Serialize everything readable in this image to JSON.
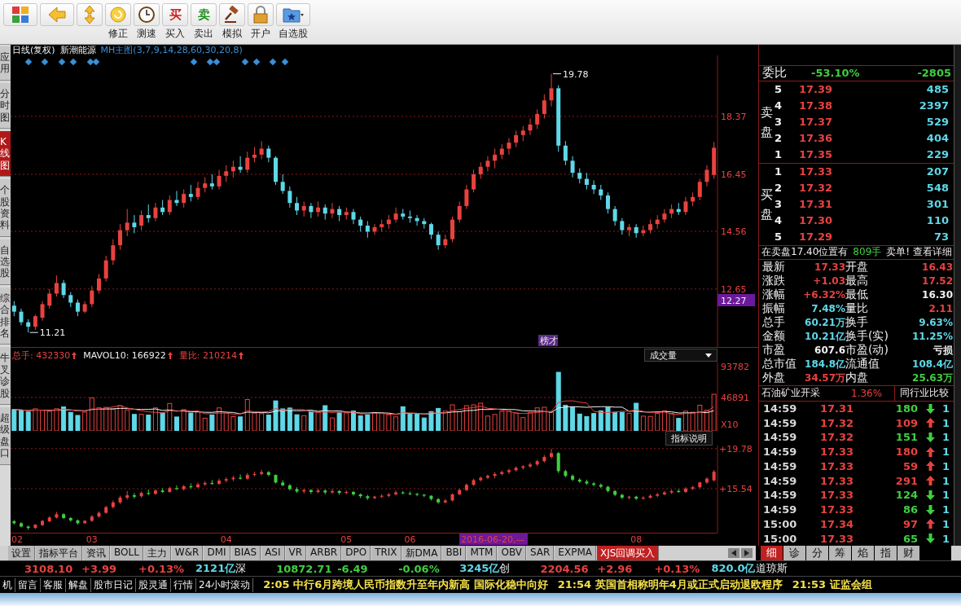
{
  "toolbar": {
    "buttons": [
      {
        "kind": "grid"
      },
      {
        "kind": "back"
      },
      {
        "kind": "updown"
      },
      {
        "kind": "refresh",
        "label": "修正"
      },
      {
        "kind": "clock",
        "label": "测速"
      },
      {
        "kind": "buy",
        "glyph": "买",
        "label": "买入"
      },
      {
        "kind": "sell",
        "glyph": "卖",
        "label": "卖出"
      },
      {
        "kind": "hammer",
        "label": "模拟"
      },
      {
        "kind": "lock",
        "label": "开户"
      },
      {
        "kind": "folder",
        "label": "自选股"
      }
    ]
  },
  "side_tabs": [
    {
      "label": "应用",
      "selected": false
    },
    {
      "label": "分时图",
      "selected": false
    },
    {
      "label": "K线图",
      "selected": true
    },
    {
      "label": "个股资料",
      "selected": false
    },
    {
      "label": "自选股",
      "selected": false
    },
    {
      "label": "综合排名",
      "selected": false
    },
    {
      "label": "牛叉诊股",
      "selected": false
    },
    {
      "label": "超级盘口",
      "selected": false
    }
  ],
  "chart": {
    "period": "日线(复权)",
    "stock": "新潮能源",
    "indicator": "MH主图(3,7,9,14,28,60,30,20,8)",
    "high_mark": "19.78",
    "low_mark": "11.21",
    "current_price": "12.27",
    "event_tag": "榜才",
    "chart_data": {
      "type": "candlestick",
      "grid": true,
      "ylim": [
        10.73,
        20.39
      ],
      "yticks": [
        {
          "value": 18.37,
          "label": "18.37"
        },
        {
          "value": 16.45,
          "label": "16.45"
        },
        {
          "value": 14.56,
          "label": "14.56"
        },
        {
          "value": 12.65,
          "label": "12.65"
        }
      ],
      "categories": [
        null,
        null,
        null,
        null,
        null,
        null,
        null,
        null,
        null,
        null,
        null,
        null,
        null,
        null,
        null,
        null,
        null,
        null,
        null,
        null,
        null,
        null,
        null,
        null,
        null,
        null,
        null,
        null,
        null,
        null,
        null,
        null,
        null,
        null,
        null,
        null,
        null,
        null,
        null,
        null,
        null,
        null,
        null,
        null,
        null,
        null,
        null,
        null,
        null,
        null,
        null,
        null,
        null,
        null,
        null,
        null,
        null,
        null,
        null,
        null,
        null,
        null,
        null,
        null,
        null,
        null,
        null,
        null,
        null,
        null,
        null,
        null,
        null,
        null,
        null,
        null,
        null,
        null,
        null,
        null,
        null,
        null,
        null,
        null,
        null,
        null,
        null,
        null,
        null,
        null,
        null,
        null,
        null,
        null,
        null,
        null,
        null,
        null,
        null,
        null
      ],
      "ohlc": [
        [
          12.1,
          12.25,
          11.75,
          11.9
        ],
        [
          11.9,
          12.0,
          11.45,
          11.55
        ],
        [
          11.55,
          11.65,
          11.21,
          11.4
        ],
        [
          11.4,
          11.8,
          11.3,
          11.75
        ],
        [
          11.7,
          12.25,
          11.6,
          12.15
        ],
        [
          12.1,
          12.65,
          12.0,
          12.5
        ],
        [
          12.5,
          13.1,
          12.4,
          12.85
        ],
        [
          12.85,
          12.95,
          12.35,
          12.45
        ],
        [
          12.45,
          12.55,
          12.05,
          12.2
        ],
        [
          12.2,
          12.3,
          11.75,
          11.9
        ],
        [
          11.9,
          12.25,
          11.85,
          12.15
        ],
        [
          12.15,
          12.75,
          12.05,
          12.6
        ],
        [
          12.6,
          13.15,
          12.5,
          13.0
        ],
        [
          13.0,
          13.75,
          12.9,
          13.6
        ],
        [
          13.6,
          14.3,
          13.45,
          14.1
        ],
        [
          14.1,
          14.8,
          13.95,
          14.6
        ],
        [
          14.6,
          15.3,
          14.4,
          14.85
        ],
        [
          14.85,
          15.1,
          14.5,
          14.7
        ],
        [
          14.75,
          15.25,
          14.6,
          15.1
        ],
        [
          15.1,
          15.45,
          14.85,
          15.0
        ],
        [
          15.0,
          15.5,
          14.9,
          15.35
        ],
        [
          15.35,
          15.6,
          15.1,
          15.2
        ],
        [
          15.2,
          15.75,
          15.1,
          15.6
        ],
        [
          15.6,
          15.9,
          15.4,
          15.5
        ],
        [
          15.5,
          15.95,
          15.35,
          15.8
        ],
        [
          15.8,
          16.1,
          15.55,
          15.7
        ],
        [
          15.7,
          16.2,
          15.6,
          16.0
        ],
        [
          16.0,
          16.35,
          15.85,
          16.15
        ],
        [
          16.15,
          16.45,
          15.95,
          16.05
        ],
        [
          16.05,
          16.6,
          15.95,
          16.4
        ],
        [
          16.4,
          16.75,
          16.2,
          16.55
        ],
        [
          16.55,
          16.9,
          16.35,
          16.7
        ],
        [
          16.7,
          17.05,
          16.5,
          16.6
        ],
        [
          16.6,
          17.2,
          16.5,
          17.0
        ],
        [
          17.0,
          17.35,
          16.85,
          17.1
        ],
        [
          17.1,
          17.55,
          16.95,
          17.3
        ],
        [
          17.3,
          17.4,
          16.85,
          17.0
        ],
        [
          17.0,
          17.05,
          16.1,
          16.2
        ],
        [
          16.2,
          16.45,
          15.8,
          15.9
        ],
        [
          15.9,
          16.05,
          15.35,
          15.5
        ],
        [
          15.5,
          15.7,
          15.1,
          15.25
        ],
        [
          15.25,
          15.55,
          15.05,
          15.4
        ],
        [
          15.4,
          15.5,
          15.0,
          15.2
        ],
        [
          15.2,
          15.55,
          15.05,
          15.35
        ],
        [
          15.35,
          15.45,
          14.95,
          15.15
        ],
        [
          15.15,
          15.5,
          15.0,
          15.3
        ],
        [
          15.3,
          15.4,
          14.9,
          15.1
        ],
        [
          15.1,
          15.35,
          14.95,
          15.2
        ],
        [
          15.2,
          15.3,
          14.8,
          14.95
        ],
        [
          14.95,
          15.05,
          14.55,
          14.75
        ],
        [
          14.75,
          14.9,
          14.35,
          14.55
        ],
        [
          14.55,
          14.8,
          14.45,
          14.7
        ],
        [
          14.7,
          14.95,
          14.55,
          14.8
        ],
        [
          14.8,
          15.1,
          14.65,
          14.95
        ],
        [
          14.95,
          15.35,
          14.85,
          15.15
        ],
        [
          15.15,
          15.3,
          14.95,
          15.05
        ],
        [
          15.05,
          15.25,
          14.85,
          15.0
        ],
        [
          15.0,
          15.1,
          14.75,
          14.9
        ],
        [
          14.9,
          15.0,
          14.65,
          14.8
        ],
        [
          14.8,
          14.85,
          14.3,
          14.45
        ],
        [
          14.45,
          14.55,
          13.95,
          14.1
        ],
        [
          14.1,
          14.45,
          14.0,
          14.3
        ],
        [
          14.3,
          15.05,
          14.2,
          14.95
        ],
        [
          14.95,
          15.55,
          14.85,
          15.4
        ],
        [
          15.4,
          16.1,
          15.3,
          15.95
        ],
        [
          15.95,
          16.6,
          15.85,
          16.45
        ],
        [
          16.45,
          16.85,
          16.3,
          16.7
        ],
        [
          16.7,
          17.05,
          16.55,
          16.9
        ],
        [
          16.9,
          17.3,
          16.65,
          17.1
        ],
        [
          17.1,
          17.45,
          16.95,
          17.3
        ],
        [
          17.3,
          17.65,
          17.1,
          17.5
        ],
        [
          17.5,
          17.9,
          17.35,
          17.75
        ],
        [
          17.75,
          18.05,
          17.55,
          17.9
        ],
        [
          17.9,
          18.3,
          17.75,
          18.1
        ],
        [
          18.1,
          18.6,
          17.95,
          18.45
        ],
        [
          18.45,
          19.1,
          18.3,
          18.9
        ],
        [
          18.9,
          19.78,
          18.7,
          19.3
        ],
        [
          19.3,
          19.4,
          17.2,
          17.4
        ],
        [
          17.4,
          17.55,
          16.75,
          16.9
        ],
        [
          16.9,
          17.05,
          16.35,
          16.5
        ],
        [
          16.5,
          16.65,
          16.15,
          16.3
        ],
        [
          16.3,
          16.5,
          15.95,
          16.1
        ],
        [
          16.1,
          16.25,
          15.8,
          15.95
        ],
        [
          15.95,
          16.1,
          15.6,
          15.75
        ],
        [
          15.75,
          15.85,
          15.15,
          15.3
        ],
        [
          15.3,
          15.4,
          14.75,
          14.9
        ],
        [
          14.9,
          15.0,
          14.45,
          14.6
        ],
        [
          14.6,
          14.8,
          14.4,
          14.7
        ],
        [
          14.7,
          14.8,
          14.35,
          14.5
        ],
        [
          14.5,
          14.75,
          14.4,
          14.6
        ],
        [
          14.6,
          14.95,
          14.5,
          14.8
        ],
        [
          14.8,
          15.1,
          14.65,
          14.95
        ],
        [
          14.95,
          15.3,
          14.85,
          15.15
        ],
        [
          15.15,
          15.45,
          15.0,
          15.3
        ],
        [
          15.3,
          15.5,
          15.1,
          15.2
        ],
        [
          15.2,
          15.7,
          15.1,
          15.55
        ],
        [
          15.55,
          15.85,
          15.4,
          15.7
        ],
        [
          15.7,
          16.3,
          15.6,
          16.2
        ],
        [
          16.2,
          16.75,
          16.05,
          16.6
        ],
        [
          16.43,
          17.52,
          16.3,
          17.33
        ]
      ]
    }
  },
  "volume": {
    "total_label": "总手:",
    "total": "432330",
    "mavol_label": "MAVOL10:",
    "mavol": "166922",
    "ratio_label": "量比:",
    "ratio": "210214",
    "selector": "成交量",
    "ticks": [
      "93782",
      "46891"
    ],
    "unit": "X10"
  },
  "indicator": {
    "explain": "指标说明",
    "chart_data": {
      "type": "candlestick",
      "grid": true,
      "ylim": [
        10.9,
        20.1
      ],
      "yticks": [
        {
          "value": 19.78,
          "label": "+19.78"
        },
        {
          "value": 15.54,
          "label": "+15.54"
        }
      ],
      "categories": [
        "02",
        null,
        null,
        null,
        null,
        null,
        null,
        null,
        null,
        null,
        null,
        "03",
        null,
        null,
        null,
        null,
        null,
        null,
        null,
        null,
        null,
        null,
        null,
        null,
        null,
        null,
        null,
        null,
        null,
        null,
        "04",
        null,
        null,
        null,
        null,
        null,
        null,
        null,
        null,
        null,
        null,
        null,
        null,
        null,
        null,
        null,
        null,
        "05",
        null,
        null,
        null,
        null,
        null,
        null,
        null,
        null,
        "06",
        null,
        null,
        null,
        null,
        null,
        null,
        null,
        null,
        null,
        null,
        null,
        null,
        null,
        null,
        null,
        null,
        null,
        null,
        null,
        null,
        null,
        null,
        null,
        null,
        null,
        null,
        null,
        null,
        null,
        null,
        null,
        "08",
        null,
        null,
        null,
        null,
        null,
        null,
        null,
        null,
        null,
        null,
        null
      ],
      "ohlc": [
        [
          12.1,
          12.25,
          11.75,
          11.9
        ],
        [
          11.9,
          12.0,
          11.45,
          11.55
        ],
        [
          11.55,
          11.65,
          11.21,
          11.4
        ],
        [
          11.4,
          11.8,
          11.3,
          11.75
        ],
        [
          11.7,
          12.25,
          11.6,
          12.15
        ],
        [
          12.1,
          12.65,
          12.0,
          12.5
        ],
        [
          12.5,
          13.1,
          12.4,
          12.85
        ],
        [
          12.85,
          12.95,
          12.35,
          12.45
        ],
        [
          12.45,
          12.55,
          12.05,
          12.2
        ],
        [
          12.2,
          12.3,
          11.75,
          11.9
        ],
        [
          11.9,
          12.25,
          11.85,
          12.15
        ],
        [
          12.15,
          12.75,
          12.05,
          12.6
        ],
        [
          12.6,
          13.15,
          12.5,
          13.0
        ],
        [
          13.0,
          13.75,
          12.9,
          13.6
        ],
        [
          13.6,
          14.3,
          13.45,
          14.1
        ],
        [
          14.1,
          14.8,
          13.95,
          14.6
        ],
        [
          14.6,
          15.3,
          14.4,
          14.85
        ],
        [
          14.85,
          15.1,
          14.5,
          14.7
        ],
        [
          14.75,
          15.25,
          14.6,
          15.1
        ],
        [
          15.1,
          15.45,
          14.85,
          15.0
        ],
        [
          15.0,
          15.5,
          14.9,
          15.35
        ],
        [
          15.35,
          15.6,
          15.1,
          15.2
        ],
        [
          15.2,
          15.75,
          15.1,
          15.6
        ],
        [
          15.6,
          15.9,
          15.4,
          15.5
        ],
        [
          15.5,
          15.95,
          15.35,
          15.8
        ],
        [
          15.8,
          16.1,
          15.55,
          15.7
        ],
        [
          15.7,
          16.2,
          15.6,
          16.0
        ],
        [
          16.0,
          16.35,
          15.85,
          16.15
        ],
        [
          16.15,
          16.45,
          15.95,
          16.05
        ],
        [
          16.05,
          16.6,
          15.95,
          16.4
        ],
        [
          16.4,
          16.75,
          16.2,
          16.55
        ],
        [
          16.55,
          16.9,
          16.35,
          16.7
        ],
        [
          16.7,
          17.05,
          16.5,
          16.6
        ],
        [
          16.6,
          17.2,
          16.5,
          17.0
        ],
        [
          17.0,
          17.35,
          16.85,
          17.1
        ],
        [
          17.1,
          17.55,
          16.95,
          17.3
        ],
        [
          17.3,
          17.4,
          16.85,
          17.0
        ],
        [
          17.0,
          17.05,
          16.1,
          16.2
        ],
        [
          16.2,
          16.45,
          15.8,
          15.9
        ],
        [
          15.9,
          16.05,
          15.35,
          15.5
        ],
        [
          15.5,
          15.7,
          15.1,
          15.25
        ],
        [
          15.25,
          15.55,
          15.05,
          15.4
        ],
        [
          15.4,
          15.5,
          15.0,
          15.2
        ],
        [
          15.2,
          15.55,
          15.05,
          15.35
        ],
        [
          15.35,
          15.45,
          14.95,
          15.15
        ],
        [
          15.15,
          15.5,
          15.0,
          15.3
        ],
        [
          15.3,
          15.4,
          14.9,
          15.1
        ],
        [
          15.1,
          15.35,
          14.95,
          15.2
        ],
        [
          15.2,
          15.3,
          14.8,
          14.95
        ],
        [
          14.95,
          15.05,
          14.55,
          14.75
        ],
        [
          14.75,
          14.9,
          14.35,
          14.55
        ],
        [
          14.55,
          14.8,
          14.45,
          14.7
        ],
        [
          14.7,
          14.95,
          14.55,
          14.8
        ],
        [
          14.8,
          15.1,
          14.65,
          14.95
        ],
        [
          14.95,
          15.35,
          14.85,
          15.15
        ],
        [
          15.15,
          15.3,
          14.95,
          15.05
        ],
        [
          15.05,
          15.25,
          14.85,
          15.0
        ],
        [
          15.0,
          15.1,
          14.75,
          14.9
        ],
        [
          14.9,
          15.0,
          14.65,
          14.8
        ],
        [
          14.8,
          14.85,
          14.3,
          14.45
        ],
        [
          14.45,
          14.55,
          13.95,
          14.1
        ],
        [
          14.1,
          14.45,
          14.0,
          14.3
        ],
        [
          14.3,
          15.05,
          14.2,
          14.95
        ],
        [
          14.95,
          15.55,
          14.85,
          15.4
        ],
        [
          15.4,
          16.1,
          15.3,
          15.95
        ],
        [
          15.95,
          16.6,
          15.85,
          16.45
        ],
        [
          16.45,
          16.85,
          16.3,
          16.7
        ],
        [
          16.7,
          17.05,
          16.55,
          16.9
        ],
        [
          16.9,
          17.3,
          16.65,
          17.1
        ],
        [
          17.1,
          17.45,
          16.95,
          17.3
        ],
        [
          17.3,
          17.65,
          17.1,
          17.5
        ],
        [
          17.5,
          17.9,
          17.35,
          17.75
        ],
        [
          17.75,
          18.05,
          17.55,
          17.9
        ],
        [
          17.9,
          18.3,
          17.75,
          18.1
        ],
        [
          18.1,
          18.6,
          17.95,
          18.45
        ],
        [
          18.45,
          19.1,
          18.3,
          18.9
        ],
        [
          18.9,
          19.78,
          18.7,
          19.3
        ],
        [
          19.3,
          19.4,
          17.2,
          17.4
        ],
        [
          17.4,
          17.55,
          16.75,
          16.9
        ],
        [
          16.9,
          17.05,
          16.35,
          16.5
        ],
        [
          16.5,
          16.65,
          16.15,
          16.3
        ],
        [
          16.3,
          16.5,
          15.95,
          16.1
        ],
        [
          16.1,
          16.25,
          15.8,
          15.95
        ],
        [
          15.95,
          16.1,
          15.6,
          15.75
        ],
        [
          15.75,
          15.85,
          15.15,
          15.3
        ],
        [
          15.3,
          15.4,
          14.75,
          14.9
        ],
        [
          14.9,
          15.0,
          14.45,
          14.6
        ],
        [
          14.6,
          14.8,
          14.4,
          14.7
        ],
        [
          14.7,
          14.8,
          14.35,
          14.5
        ],
        [
          14.5,
          14.75,
          14.4,
          14.6
        ],
        [
          14.6,
          14.95,
          14.5,
          14.8
        ],
        [
          14.8,
          15.1,
          14.65,
          14.95
        ],
        [
          14.95,
          15.3,
          14.85,
          15.15
        ],
        [
          15.15,
          15.45,
          15.0,
          15.3
        ],
        [
          15.3,
          15.5,
          15.1,
          15.2
        ],
        [
          15.2,
          15.7,
          15.1,
          15.55
        ],
        [
          15.55,
          15.85,
          15.4,
          15.7
        ],
        [
          15.7,
          16.3,
          15.6,
          16.2
        ],
        [
          16.2,
          16.75,
          16.05,
          16.6
        ],
        [
          16.43,
          17.52,
          16.3,
          17.33
        ]
      ]
    }
  },
  "cursor_date": "2016-06-20,—",
  "bottom_tabs": [
    {
      "label": "设置",
      "selected": false
    },
    {
      "label": "指标平台",
      "selected": false
    },
    {
      "label": "资讯",
      "selected": false
    },
    {
      "label": "BOLL",
      "selected": false
    },
    {
      "label": "主力",
      "selected": false
    },
    {
      "label": "W&R",
      "selected": false
    },
    {
      "label": "DMI",
      "selected": false
    },
    {
      "label": "BIAS",
      "selected": false
    },
    {
      "label": "ASI",
      "selected": false
    },
    {
      "label": "VR",
      "selected": false
    },
    {
      "label": "ARBR",
      "selected": false
    },
    {
      "label": "DPO",
      "selected": false
    },
    {
      "label": "TRIX",
      "selected": false
    },
    {
      "label": "新DMA",
      "selected": false
    },
    {
      "label": "BBI",
      "selected": false
    },
    {
      "label": "MTM",
      "selected": false
    },
    {
      "label": "OBV",
      "selected": false
    },
    {
      "label": "SAR",
      "selected": false
    },
    {
      "label": "EXPMA",
      "selected": false
    },
    {
      "label": "XJS回调买入",
      "selected": true
    }
  ],
  "quote": {
    "ratio": {
      "label": "委比",
      "pct": "-53.10%",
      "diff": "-2805"
    },
    "sell": {
      "label": "卖盘",
      "levels": [
        {
          "level": "5",
          "price": "17.39",
          "qty": "485"
        },
        {
          "level": "4",
          "price": "17.38",
          "qty": "2397"
        },
        {
          "level": "3",
          "price": "17.37",
          "qty": "529"
        },
        {
          "level": "2",
          "price": "17.36",
          "qty": "404"
        },
        {
          "level": "1",
          "price": "17.35",
          "qty": "229"
        }
      ]
    },
    "buy": {
      "label": "买盘",
      "levels": [
        {
          "level": "1",
          "price": "17.33",
          "qty": "207"
        },
        {
          "level": "2",
          "price": "17.32",
          "qty": "548"
        },
        {
          "level": "3",
          "price": "17.31",
          "qty": "301"
        },
        {
          "level": "4",
          "price": "17.30",
          "qty": "110"
        },
        {
          "level": "5",
          "price": "17.29",
          "qty": "73"
        }
      ]
    },
    "notice": {
      "before": "在卖盘17.40位置有",
      "qty": "809手",
      "after": "卖单! 查看详细"
    },
    "stats": [
      {
        "label": "最新",
        "value": "17.33",
        "color": "#e8423f"
      },
      {
        "label": "开盘",
        "value": "16.43",
        "color": "#e8423f"
      },
      {
        "label": "涨跌",
        "value": "+1.03",
        "color": "#e8423f"
      },
      {
        "label": "最高",
        "value": "17.52",
        "color": "#e8423f"
      },
      {
        "label": "涨幅",
        "value": "+6.32%",
        "color": "#e8423f"
      },
      {
        "label": "最低",
        "value": "16.30",
        "color": "#f0f0f0"
      },
      {
        "label": "振幅",
        "value": "7.48%",
        "color": "#5fd8e8"
      },
      {
        "label": "量比",
        "value": "2.11",
        "color": "#e8423f"
      },
      {
        "label": "总手",
        "value": "60.21万",
        "color": "#5fd8e8"
      },
      {
        "label": "换手",
        "value": "9.63%",
        "color": "#5fd8e8"
      },
      {
        "label": "金额",
        "value": "10.21亿",
        "color": "#5fd8e8"
      },
      {
        "label": "换手(实)",
        "value": "11.25%",
        "color": "#5fd8e8"
      },
      {
        "label": "市盈",
        "value": "607.6",
        "color": "#f0f0f0"
      },
      {
        "label": "市盈(动)",
        "value": "亏损",
        "color": "#f0f0f0"
      },
      {
        "label": "总市值",
        "value": "184.8亿",
        "color": "#5fd8e8"
      },
      {
        "label": "流通值",
        "value": "108.4亿",
        "color": "#5fd8e8"
      },
      {
        "label": "外盘",
        "value": "34.57万",
        "color": "#e8423f"
      },
      {
        "label": "内盘",
        "value": "25.63万",
        "color": "#3fcf3f"
      }
    ],
    "industry": {
      "name": "石油矿业开采",
      "pct": "1.36%",
      "button": "同行业比较"
    },
    "trades": [
      {
        "time": "14:59",
        "price": "17.31",
        "volume": "180",
        "kind": "down",
        "column_4": "1"
      },
      {
        "time": "14:59",
        "price": "17.32",
        "volume": "109",
        "kind": "up",
        "column_4": "1"
      },
      {
        "time": "14:59",
        "price": "17.32",
        "volume": "151",
        "kind": "down",
        "column_4": "1"
      },
      {
        "time": "14:59",
        "price": "17.33",
        "volume": "180",
        "kind": "up",
        "column_4": "1"
      },
      {
        "time": "14:59",
        "price": "17.33",
        "volume": "59",
        "kind": "up",
        "column_4": "1"
      },
      {
        "time": "14:59",
        "price": "17.33",
        "volume": "291",
        "kind": "up",
        "column_4": "1"
      },
      {
        "time": "14:59",
        "price": "17.33",
        "volume": "124",
        "kind": "down",
        "column_4": "1"
      },
      {
        "time": "14:59",
        "price": "17.33",
        "volume": "86",
        "kind": "down",
        "column_4": "1"
      },
      {
        "time": "15:00",
        "price": "17.34",
        "volume": "97",
        "kind": "up",
        "column_4": "1"
      },
      {
        "time": "15:00",
        "price": "17.33",
        "volume": "65",
        "kind": "down",
        "column_4": "1"
      }
    ]
  },
  "right_tabs": [
    {
      "label": "细",
      "selected": true
    },
    {
      "label": "诊",
      "selected": false
    },
    {
      "label": "分",
      "selected": false
    },
    {
      "label": "筹",
      "selected": false
    },
    {
      "label": "焰",
      "selected": false
    },
    {
      "label": "指",
      "selected": false
    },
    {
      "label": "财",
      "selected": false
    }
  ],
  "index_bar": [
    {
      "text": "3108.10",
      "kind": "up"
    },
    {
      "text": "+3.99",
      "kind": "up"
    },
    {
      "text": "+0.13%",
      "kind": "up"
    },
    {
      "text": "2121亿",
      "kind": "amount"
    },
    {
      "text": "深",
      "kind": "name"
    },
    {
      "text": "10872.71",
      "kind": "down"
    },
    {
      "text": "-6.49",
      "kind": "down"
    },
    {
      "text": "-0.06%",
      "kind": "down"
    },
    {
      "text": "3245亿",
      "kind": "amount"
    },
    {
      "text": "创",
      "kind": "name"
    },
    {
      "text": "2204.56",
      "kind": "up"
    },
    {
      "text": "+2.96",
      "kind": "up"
    },
    {
      "text": "+0.13%",
      "kind": "up"
    },
    {
      "text": "820.0亿",
      "kind": "amount"
    },
    {
      "text": "道琼斯",
      "kind": "name"
    }
  ],
  "news_bar": {
    "buttons": [
      "机",
      "留言",
      "客服",
      "解盘",
      "股市日记",
      "股灵通",
      "行情",
      "24小时滚动"
    ],
    "headlines": [
      "2:05 中行6月跨境人民币指数升至年内新高 国际化稳中向好",
      "21:54 英国首相称明年4月或正式启动退欧程序",
      "21:53 证监会组"
    ]
  }
}
